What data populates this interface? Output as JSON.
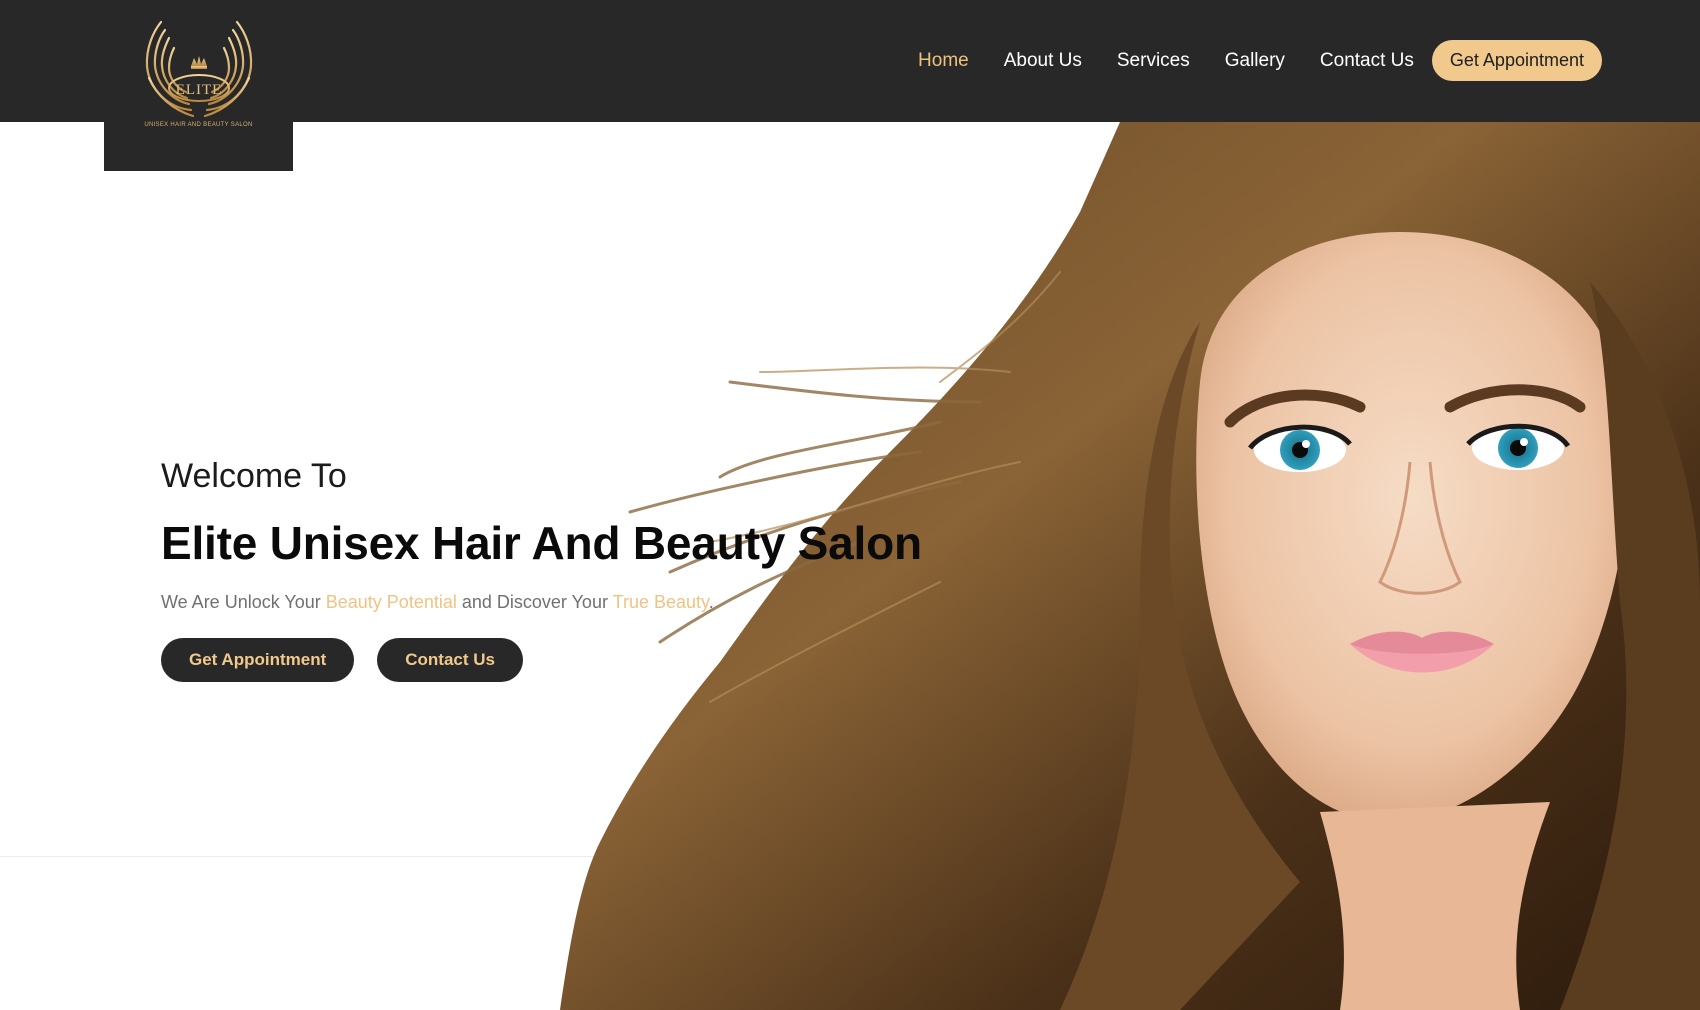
{
  "brand": {
    "logo_letters": "ELITE",
    "tagline": "UNISEX HAIR AND BEAUTY SALON",
    "accent_color": "#efc27b",
    "dark_color": "#282828"
  },
  "nav": {
    "items": [
      {
        "label": "Home",
        "active": true
      },
      {
        "label": "About Us",
        "active": false
      },
      {
        "label": "Services",
        "active": false
      },
      {
        "label": "Gallery",
        "active": false
      },
      {
        "label": "Contact Us",
        "active": false
      }
    ],
    "cta_label": "Get Appointment"
  },
  "hero": {
    "welcome": "Welcome To",
    "title": "Elite Unisex Hair And Beauty Salon",
    "subtitle": {
      "part1": "We Are Unlock Your ",
      "accent1": "Beauty Potential",
      "part2": " and Discover Your ",
      "accent2": "True Beauty",
      "part3": "."
    },
    "buttons": {
      "appointment": "Get Appointment",
      "contact": "Contact Us"
    },
    "image_alt": "woman-with-long-flowing-hair-photo"
  }
}
